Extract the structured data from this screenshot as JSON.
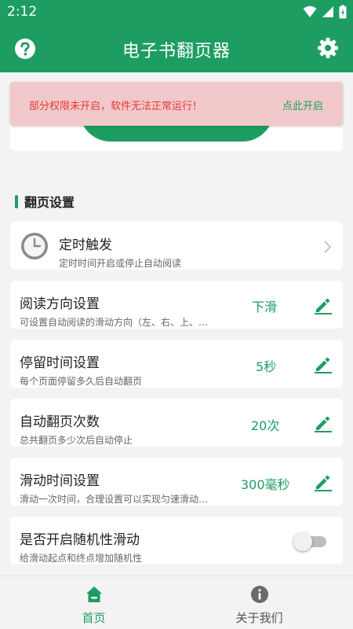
{
  "status_bar": {
    "time": "2:12"
  },
  "app_bar": {
    "title": "电子书翻页器"
  },
  "alert": {
    "message": "部分权限未开启，软件无法正常运行！",
    "action": "点此开启"
  },
  "section": {
    "title": "翻页设置"
  },
  "cards": [
    {
      "title": "定时触发",
      "desc": "定时时间开启或停止自动阅读"
    },
    {
      "title": "阅读方向设置",
      "desc": "可设置自动阅读的滑动方向（左、右、上、…",
      "value": "下滑"
    },
    {
      "title": "停留时间设置",
      "desc": "每个页面停留多久后自动翻页",
      "value": "5秒"
    },
    {
      "title": "自动翻页次数",
      "desc": "总共翻页多少次后自动停止",
      "value": "20次"
    },
    {
      "title": "滑动时间设置",
      "desc": "滑动一次时间，合理设置可以实现匀速滑动…",
      "value": "300毫秒"
    },
    {
      "title": "是否开启随机性滑动",
      "desc": "给滑动起点和终点增加随机性",
      "toggle_on": false
    }
  ],
  "bottom_nav": {
    "home": "首页",
    "about": "关于我们"
  },
  "colors": {
    "primary": "#1e9d63",
    "alert_bg": "#f2c9cb",
    "alert_text": "#e53935"
  }
}
